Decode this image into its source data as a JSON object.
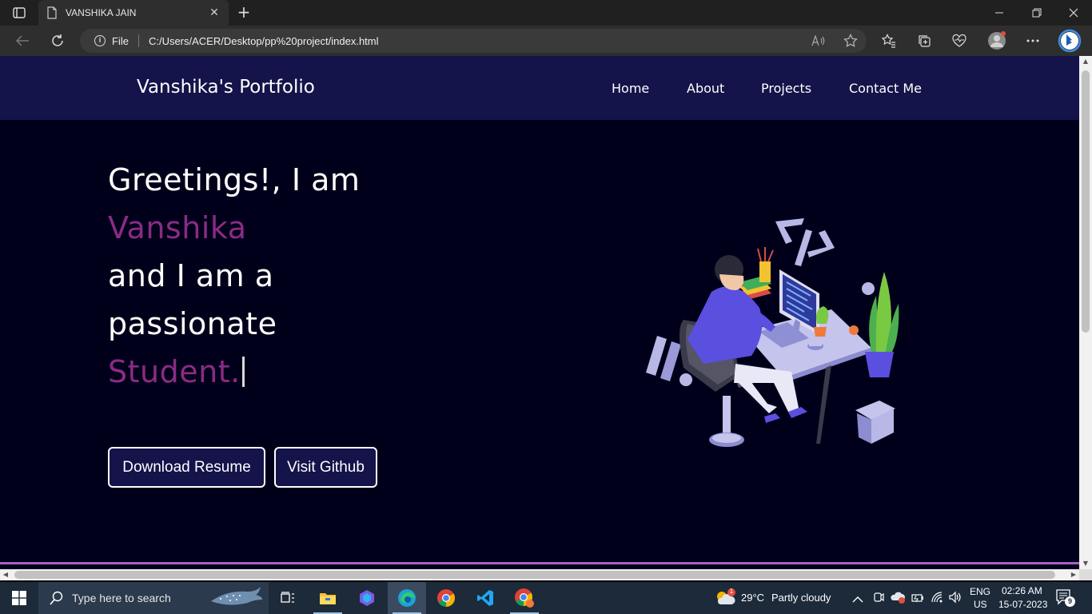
{
  "browser": {
    "tab_title": "VANSHIKA JAIN",
    "address_scheme": "File",
    "address_url": "C:/Users/ACER/Desktop/pp%20project/index.html"
  },
  "site": {
    "brand": "Vanshika's Portfolio",
    "nav": [
      "Home",
      "About",
      "Projects",
      "Contact Me"
    ],
    "hero": {
      "line1": "Greetings!, I am",
      "name": "Vanshika",
      "line3": "and I am a",
      "line4": "passionate",
      "role": "Student."
    },
    "buttons": {
      "resume": "Download Resume",
      "github": "Visit Github"
    }
  },
  "taskbar": {
    "search_placeholder": "Type here to search",
    "weather_temp": "29°C",
    "weather_desc": "Partly cloudy",
    "weather_badge": "1",
    "lang": "ENG",
    "region": "US",
    "time": "02:26 AM",
    "date": "15-07-2023",
    "notification_count": "9"
  },
  "colors": {
    "nav_bg": "#14134a",
    "page_bg": "#00001a",
    "accent_purple": "#8a2b85",
    "divider": "#a95fc7"
  }
}
